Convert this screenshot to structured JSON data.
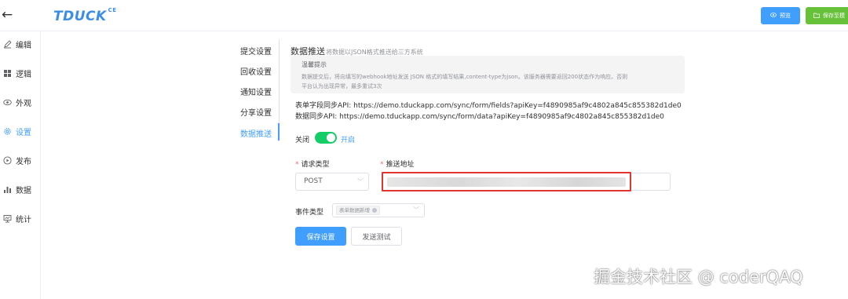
{
  "topbar": {
    "back_icon": "arrow-left-icon",
    "logo": "TDUCK",
    "logo_sup": "CE",
    "preview_label": "预览",
    "save_label": "保存至模",
    "colors": {
      "logo": "#3a8ee6",
      "primary": "#409eff",
      "success": "#67c23a"
    }
  },
  "sidebar": {
    "items": [
      {
        "label": "编辑",
        "icon": "edit-icon"
      },
      {
        "label": "逻辑",
        "icon": "grid-icon"
      },
      {
        "label": "外观",
        "icon": "eye-icon"
      },
      {
        "label": "设置",
        "icon": "gear-icon",
        "active": true
      },
      {
        "label": "发布",
        "icon": "play-icon"
      },
      {
        "label": "数据",
        "icon": "bar-chart-icon"
      },
      {
        "label": "统计",
        "icon": "monitor-icon"
      }
    ]
  },
  "settings_nav": {
    "items": [
      {
        "label": "提交设置"
      },
      {
        "label": "回收设置"
      },
      {
        "label": "通知设置"
      },
      {
        "label": "分享设置"
      },
      {
        "label": "数据推送",
        "active": true
      }
    ]
  },
  "main": {
    "title": "数据推送",
    "subtitle": "将数据以JSON格式推送给三方系统",
    "tip": {
      "title": "温馨提示",
      "text_line1": "数据提交后，将向填写的webhook地址发送 JSON 格式的填写结果,content-type为json。该服务器需要返回200状态作为响应。否则",
      "text_line2": "平台认为出现异常，最多重试3次"
    },
    "api_fields": "表单字段同步API: https://demo.tduckapp.com/sync/form/fields?apiKey=f4890985af9c4802a845c855382d1de0",
    "api_data": "数据同步API: https://demo.tduckapp.com/sync/form/data?apiKey=f4890985af9c4802a845c855382d1de0",
    "switch": {
      "off_label": "关闭",
      "on_label": "开启",
      "on": true
    },
    "request_type": {
      "label": "请求类型",
      "value": "POST"
    },
    "push_url": {
      "label": "推送地址",
      "value": ""
    },
    "event_type": {
      "label": "事件类型",
      "tag": "表单数据新增"
    },
    "save_button": "保存设置",
    "test_button": "发送测试"
  },
  "watermark": "掘金技术社区 @ coderQAQ"
}
